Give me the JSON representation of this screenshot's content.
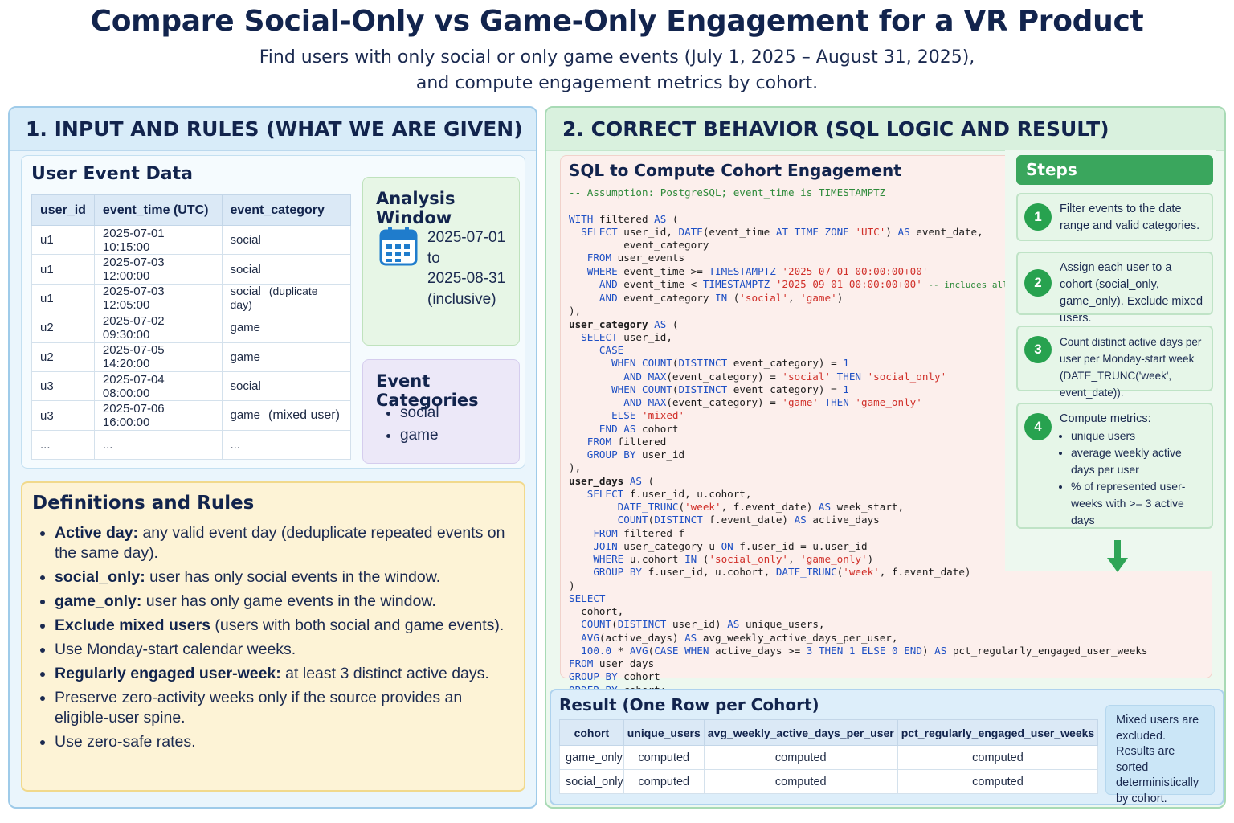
{
  "header": {
    "title": "Compare Social-Only vs Game-Only Engagement for a VR Product",
    "subtitle_line1": "Find users with only social or only game events (July 1, 2025 – August 31, 2025),",
    "subtitle_line2": "and compute engagement metrics by cohort."
  },
  "left_panel": {
    "title": "1. INPUT AND RULES (WHAT WE ARE GIVEN)",
    "events": {
      "title": "User Event Data",
      "columns": [
        "user_id",
        "event_time (UTC)",
        "event_category"
      ],
      "rows": [
        {
          "user_id": "u1",
          "time": "2025-07-01 10:15:00",
          "category": "social",
          "note": ""
        },
        {
          "user_id": "u1",
          "time": "2025-07-03 12:00:00",
          "category": "social",
          "note": ""
        },
        {
          "user_id": "u1",
          "time": "2025-07-03 12:05:00",
          "category": "social",
          "note": "(duplicate day)"
        },
        {
          "user_id": "u2",
          "time": "2025-07-02 09:30:00",
          "category": "game",
          "note": ""
        },
        {
          "user_id": "u2",
          "time": "2025-07-05 14:20:00",
          "category": "game",
          "note": ""
        },
        {
          "user_id": "u3",
          "time": "2025-07-04 08:00:00",
          "category": "social",
          "note": ""
        },
        {
          "user_id": "u3",
          "time": "2025-07-06 16:00:00",
          "category": "game",
          "note": "(mixed user)"
        },
        {
          "user_id": "...",
          "time": "...",
          "category": "...",
          "note": ""
        }
      ]
    },
    "window": {
      "title": "Analysis Window",
      "icon": "calendar-icon",
      "start": "2025-07-01",
      "to": "to",
      "end": "2025-08-31",
      "inclusive": "(inclusive)"
    },
    "categories": {
      "title": "Event Categories",
      "items": [
        "social",
        "game"
      ]
    },
    "definitions": {
      "title": "Definitions and Rules",
      "rules": [
        {
          "bold": "Active day:",
          "text": " any valid event day (deduplicate repeated events on the same day)."
        },
        {
          "bold": "social_only:",
          "text": " user has only social events in the window."
        },
        {
          "bold": "game_only:",
          "text": " user has only game events in the window."
        },
        {
          "bold": "Exclude mixed users",
          "text": " (users with both social and game events)."
        },
        {
          "bold": "",
          "text": "Use Monday-start calendar weeks."
        },
        {
          "bold": "Regularly engaged user-week:",
          "text": " at least 3 distinct active days."
        },
        {
          "bold": "",
          "text": "Preserve zero-activity weeks only if the source provides an eligible-user spine."
        },
        {
          "bold": "",
          "text": "Use zero-safe rates."
        }
      ]
    }
  },
  "right_panel": {
    "title": "2. CORRECT BEHAVIOR (SQL LOGIC AND RESULT)",
    "sql_title": "SQL to Compute Cohort Engagement",
    "steps_title": "Steps",
    "steps": [
      {
        "n": "1",
        "text": "Filter events to the date range and valid categories."
      },
      {
        "n": "2",
        "text": "Assign each user to a cohort (social_only, game_only). Exclude mixed users."
      },
      {
        "n": "3",
        "text": "Count distinct active days per user per Monday-start week (DATE_TRUNC('week', event_date))."
      },
      {
        "n": "4",
        "text": "Compute metrics:",
        "bullets": [
          "unique users",
          "average weekly active days per user",
          "% of represented user-weeks with >= 3 active days"
        ]
      }
    ],
    "result": {
      "title": "Result (One Row per Cohort)",
      "columns": [
        "cohort",
        "unique_users",
        "avg_weekly_active_days_per_user",
        "pct_regularly_engaged_user_weeks"
      ],
      "rows": [
        [
          "game_only",
          "computed",
          "computed",
          "computed"
        ],
        [
          "social_only",
          "computed",
          "computed",
          "computed"
        ]
      ],
      "note": "Mixed users are excluded. Results are sorted deterministically by cohort."
    }
  },
  "colors": {
    "title_navy": "#12244d",
    "left_panel_bg": "#eaf5fc",
    "right_panel_bg": "#edf8ef",
    "rules_bg": "#fdf3d6",
    "sql_bg": "#fcefec",
    "step_badge": "#27a24f",
    "sql_keyword": "#1d4fc4",
    "sql_string": "#d0302a",
    "sql_comment": "#2e8a3a"
  }
}
